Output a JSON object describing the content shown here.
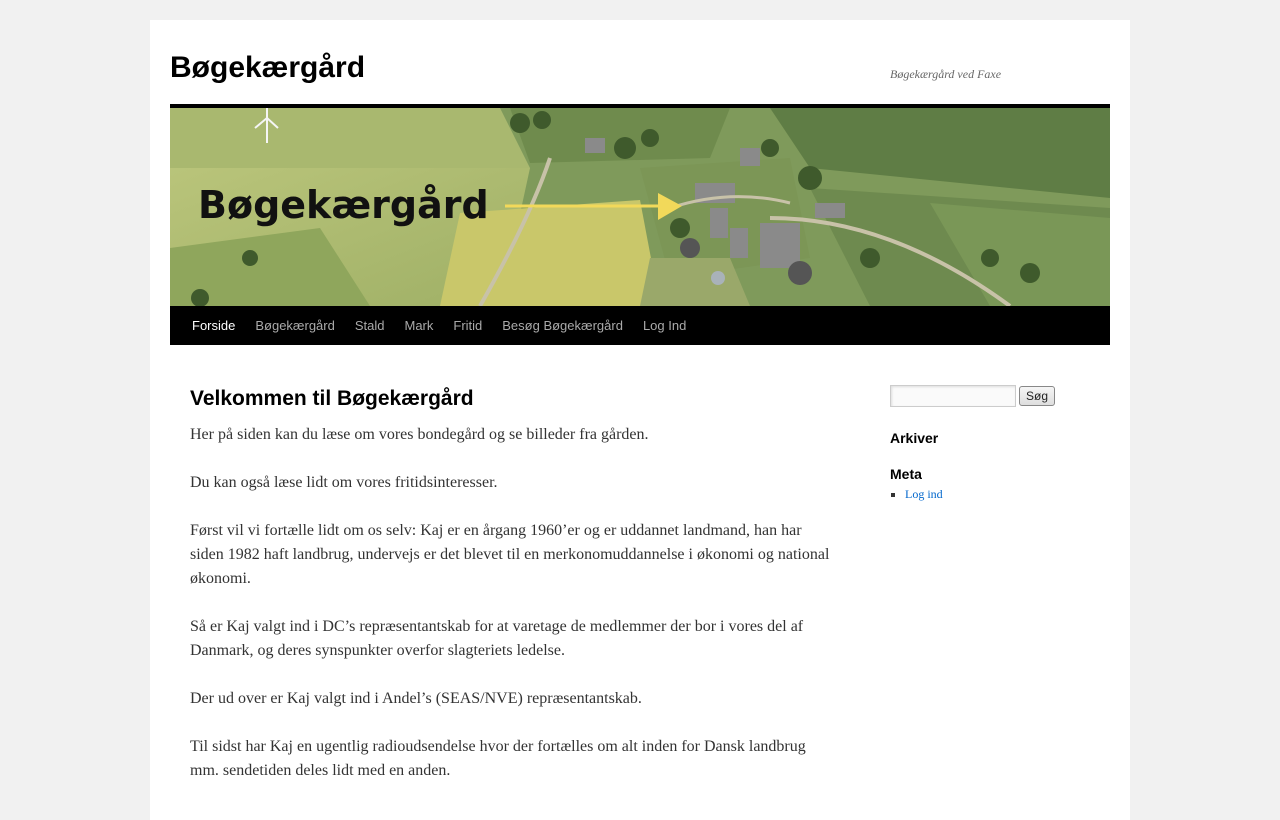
{
  "site": {
    "title": "Bøgekærgård",
    "description": "Bøgekærgård ved Faxe"
  },
  "banner": {
    "overlay_text": "Bøgekærgård"
  },
  "nav": {
    "items": [
      {
        "label": "Forside",
        "current": true
      },
      {
        "label": "Bøgekærgård",
        "current": false
      },
      {
        "label": "Stald",
        "current": false
      },
      {
        "label": "Mark",
        "current": false
      },
      {
        "label": "Fritid",
        "current": false
      },
      {
        "label": "Besøg Bøgekærgård",
        "current": false
      },
      {
        "label": "Log Ind",
        "current": false
      }
    ]
  },
  "content": {
    "title": "Velkommen til Bøgekærgård",
    "paragraphs": [
      "Her på siden kan du læse om vores bondegård og se billeder fra gården.",
      "Du kan også læse lidt om vores fritidsinteresser.",
      "Først vil vi fortælle lidt om os selv: Kaj er en årgang 1960’er og er uddannet landmand, han har siden 1982 haft landbrug, undervejs er det blevet til en merkonomuddannelse i økonomi og national økonomi.",
      "Så er Kaj valgt ind i DC’s repræsentantskab for at varetage de medlemmer der bor i vores del af Danmark, og deres synspunkter overfor slagteriets ledelse.",
      "Der ud over er Kaj valgt ind i Andel’s (SEAS/NVE) repræsentantskab.",
      "Til sidst har Kaj en ugentlig radioudsendelse hvor der fortælles om alt inden for Dansk landbrug mm. sendetiden deles lidt med en anden."
    ]
  },
  "sidebar": {
    "search": {
      "value": "",
      "button_label": "Søg"
    },
    "archives_title": "Arkiver",
    "meta_title": "Meta",
    "meta_links": [
      "Log ind"
    ]
  },
  "colors": {
    "page_bg": "#f1f1f1",
    "nav_bg": "#000000",
    "nav_text": "#aaaaaa",
    "nav_current": "#ffffff",
    "link": "#0066cc"
  }
}
